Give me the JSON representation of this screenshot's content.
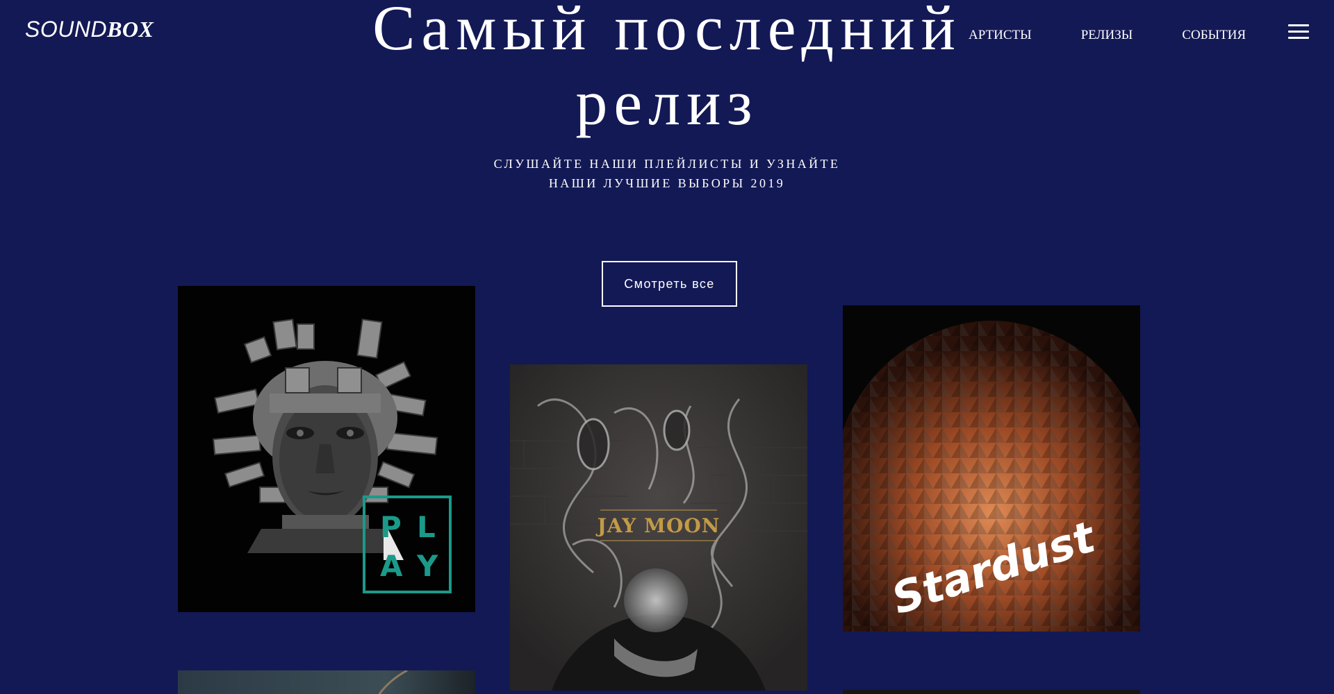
{
  "header": {
    "logo_part1": "SOUND",
    "logo_part2": "BOX",
    "nav": [
      "АРТИСТЫ",
      "РЕЛИЗЫ",
      "СОБЫТИЯ"
    ],
    "menu_icon": "hamburger-icon"
  },
  "hero": {
    "title_line1": "Самый последний",
    "title_line2": "релиз",
    "subtitle_line1": "СЛУШАЙТЕ НАШИ ПЛЕЙЛИСТЫ И УЗНАЙТЕ",
    "subtitle_line2": "НАШИ ЛУЧШИЕ ВЫБОРЫ 2019",
    "button": "Смотреть все"
  },
  "albums": [
    {
      "cover_text": [
        "P",
        "L",
        "A",
        "Y"
      ],
      "accent": "#1b9a8a"
    },
    {
      "cover_text": "JAY MOON",
      "accent": "#c39b46"
    },
    {
      "cover_text": "Stardust",
      "accent": "#b35a2e"
    }
  ],
  "colors": {
    "background": "#131955",
    "text": "#ffffff"
  }
}
